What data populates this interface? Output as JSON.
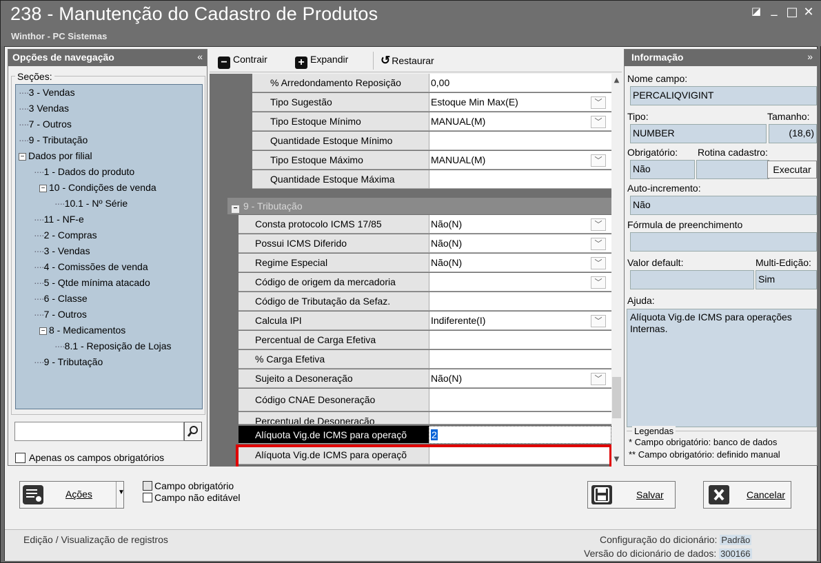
{
  "window": {
    "title": "238 - Manutenção do Cadastro de Produtos",
    "subtitle": "Winthor - PC Sistemas",
    "restore_glyph": "◪",
    "minimize_glyph": "_",
    "maximize_glyph": "□",
    "close_glyph": "✕"
  },
  "nav": {
    "header": "Opções de navegação",
    "collapse_glyph": "«",
    "sections_label": "Seções:",
    "tree": [
      {
        "label": "3 - Vendas"
      },
      {
        "label": "3 Vendas"
      },
      {
        "label": "7 - Outros"
      },
      {
        "label": "9 - Tributação"
      },
      {
        "label": "Dados por filial"
      },
      {
        "label": "1 - Dados do produto"
      },
      {
        "label": "10 - Condições de venda"
      },
      {
        "label": "10.1 - Nº Série"
      },
      {
        "label": "11 - NF-e"
      },
      {
        "label": "2 - Compras"
      },
      {
        "label": "3 - Vendas"
      },
      {
        "label": "4 - Comissões de venda"
      },
      {
        "label": "5 - Qtde mínima atacado"
      },
      {
        "label": "6 - Classe"
      },
      {
        "label": "7 - Outros"
      },
      {
        "label": "8 - Medicamentos"
      },
      {
        "label": "8.1 -  Reposição de Lojas"
      },
      {
        "label": "9 - Tributação"
      }
    ],
    "search_value": "",
    "search_icon": "search-icon",
    "only_required_label": "Apenas os campos obrigatórios"
  },
  "toolbar": {
    "contract": "Contrair",
    "expand": "Expandir",
    "restore": "Restaurar"
  },
  "grid": {
    "rows_top": [
      {
        "label": "% Arredondamento Reposição",
        "value": "0,00",
        "dropdown": false
      },
      {
        "label": "Tipo Sugestão",
        "value": "Estoque Min Max(E)",
        "dropdown": true
      },
      {
        "label": "Tipo Estoque Mínimo",
        "value": "MANUAL(M)",
        "dropdown": true
      },
      {
        "label": "Quantidade Estoque Mínimo",
        "value": "",
        "dropdown": false
      },
      {
        "label": "Tipo Estoque Máximo",
        "value": "MANUAL(M)",
        "dropdown": true
      },
      {
        "label": "Quantidade Estoque Máxima",
        "value": "",
        "dropdown": false
      }
    ],
    "group_label": "9 - Tributação",
    "rows_tax": [
      {
        "label": "Consta protocolo ICMS 17/85",
        "value": "Não(N)",
        "dropdown": true
      },
      {
        "label": "Possui ICMS Diferido",
        "value": "Não(N)",
        "dropdown": true
      },
      {
        "label": "Regime Especial",
        "value": "Não(N)",
        "dropdown": true
      },
      {
        "label": "Código de origem da mercadoria",
        "value": "",
        "dropdown": true
      },
      {
        "label": "Código de Tributação da Sefaz.",
        "value": "",
        "dropdown": false
      },
      {
        "label": "Calcula IPI",
        "value": "Indiferente(I)",
        "dropdown": true
      },
      {
        "label": "Percentual de Carga Efetiva",
        "value": "",
        "dropdown": false
      },
      {
        "label": "% Carga Efetiva",
        "value": "",
        "dropdown": false
      },
      {
        "label": "Sujeito a Desoneração",
        "value": "Não(N)",
        "dropdown": true
      },
      {
        "label": "Código CNAE Desoneração",
        "value": "",
        "dropdown": false,
        "ellipsis": "..."
      },
      {
        "label": "Percentual de Desoneração",
        "value": "",
        "dropdown": false
      },
      {
        "label": "Alíquota Vig.de ICMS para operaçõ",
        "value": "2",
        "dropdown": false,
        "selected": true
      },
      {
        "label": "Alíquota Vig.de ICMS para operaçõ",
        "value": "",
        "dropdown": false
      }
    ]
  },
  "info": {
    "header": "Informação",
    "collapse_glyph": "»",
    "field_name_label": "Nome campo:",
    "field_name": "PERCALIQVIGINT",
    "type_label": "Tipo:",
    "size_label": "Tamanho:",
    "type": "NUMBER",
    "size": "(18,6)",
    "required_label": "Obrigatório:",
    "routine_label": "Rotina cadastro:",
    "required": "Não",
    "execute_label": "Executar",
    "autoinc_label": "Auto-incremento:",
    "autoinc": "Não",
    "formula_label": "Fórmula de preenchimento",
    "formula": "",
    "default_label": "Valor default:",
    "multiedit_label": "Multi-Edição:",
    "default_value": "",
    "multiedit": "Sim",
    "help_label": "Ajuda:",
    "help_text": "Alíquota Vig.de ICMS para operações Internas.",
    "legend_label": "Legendas",
    "legend_1": "* Campo obrigatório: banco de dados",
    "legend_2": "** Campo obrigatório: definido manual"
  },
  "bottom": {
    "actions_label": "Ações",
    "legend_required": "Campo obrigatório",
    "legend_readonly": "Campo não editável",
    "save_label": "Salvar",
    "cancel_label": "Cancelar"
  },
  "status": {
    "left": "Edição / Visualização de registros",
    "config_label": "Configuração do dicionário:",
    "config_value": "Padrão",
    "version_label": "Versão do dicionário de dados:",
    "version_value": "300166"
  },
  "colors": {
    "highlight_border": "#e00000",
    "tree_bg": "#b7c9d8",
    "selection": "#0a64d8"
  }
}
